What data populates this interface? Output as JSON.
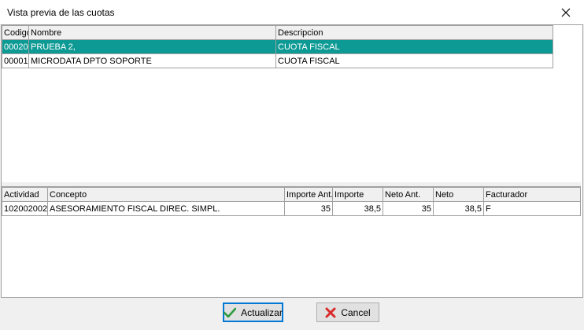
{
  "window": {
    "title": "Vista previa de las cuotas"
  },
  "top_table": {
    "columns": [
      "Codigo",
      "Nombre",
      "Descripcion"
    ],
    "rows": [
      {
        "codigo": "00020",
        "nombre": "PRUEBA 2,",
        "descripcion": "CUOTA FISCAL"
      },
      {
        "codigo": "00001",
        "nombre": "MICRODATA DPTO SOPORTE",
        "descripcion": "CUOTA FISCAL"
      }
    ]
  },
  "bottom_table": {
    "columns": [
      "Actividad",
      "Concepto",
      "Importe Ant.",
      "Importe",
      "Neto Ant.",
      "Neto",
      "Facturador"
    ],
    "rows": [
      {
        "actividad": "102002002",
        "concepto": "ASESORAMIENTO FISCAL DIREC. SIMPL.",
        "importe_ant": "35",
        "importe": "38,5",
        "neto_ant": "35",
        "neto": "38,5",
        "facturador": "F"
      }
    ]
  },
  "buttons": {
    "update": "Actualizar",
    "cancel": "Cancel"
  },
  "colors": {
    "selection": "#0e9a94",
    "update_icon": "#2e9b3f",
    "cancel_icon": "#d92b2b"
  }
}
